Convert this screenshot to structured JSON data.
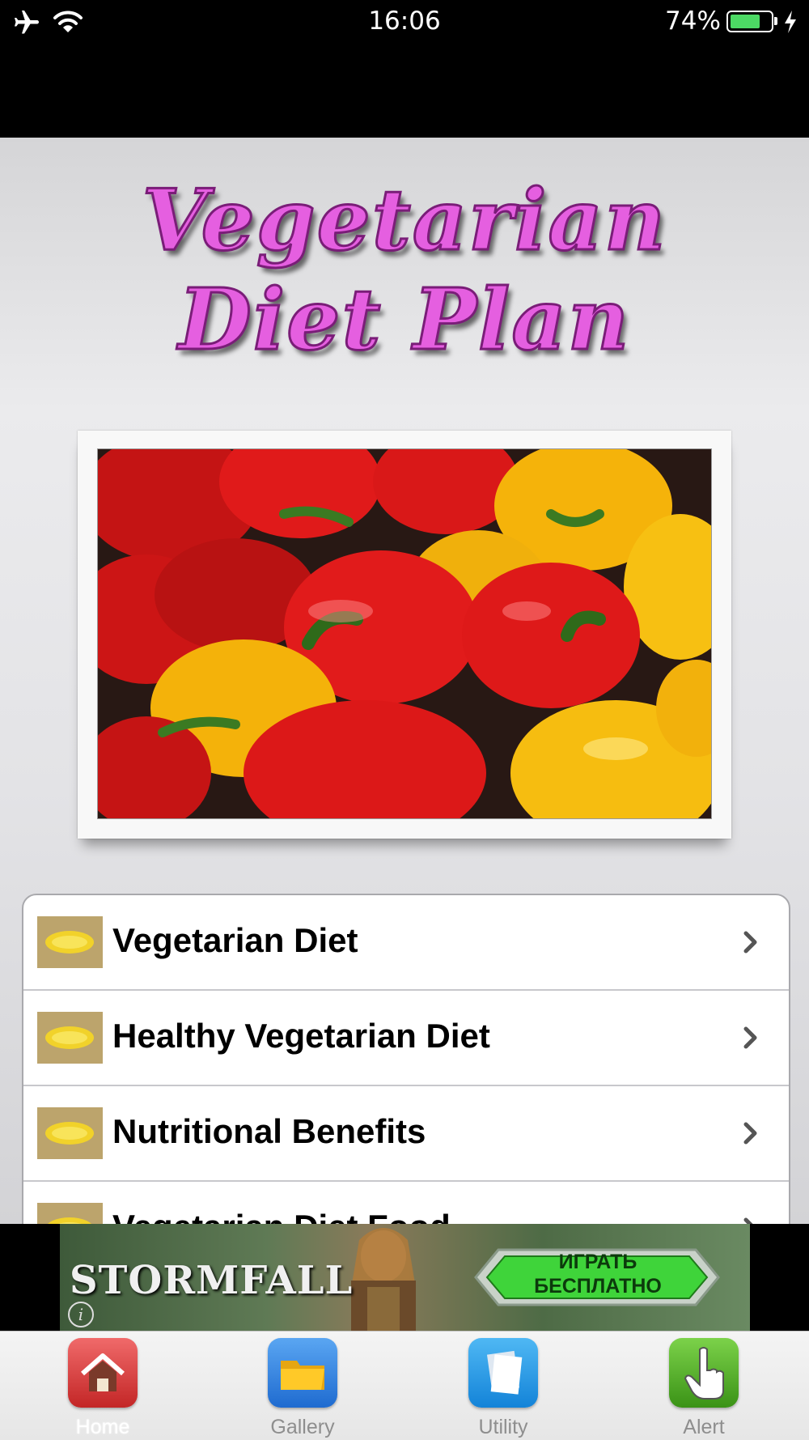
{
  "status_bar": {
    "time": "16:06",
    "battery_percent": "74%",
    "battery_level": 0.74,
    "icons": [
      "airplane-icon",
      "wifi-icon",
      "battery-icon",
      "charging-bolt-icon"
    ]
  },
  "header": {
    "title": "Vegetarian Diet Plan"
  },
  "hero_image": {
    "subject": "red and yellow bell peppers"
  },
  "menu": {
    "items": [
      {
        "label": "Vegetarian Diet",
        "icon": "lemon-thumbnail"
      },
      {
        "label": "Healthy Vegetarian Diet",
        "icon": "lemon-thumbnail"
      },
      {
        "label": "Nutritional Benefits",
        "icon": "lemon-thumbnail"
      },
      {
        "label": "Vegetarian Diet Food",
        "icon": "lemon-thumbnail"
      }
    ]
  },
  "ad_banner": {
    "brand": "STORMFALL",
    "cta": "ИГРАТЬ БЕСПЛАТНО",
    "info_icon": "i"
  },
  "tab_bar": {
    "tabs": [
      {
        "label": "Home",
        "icon": "home-icon",
        "active": true
      },
      {
        "label": "Gallery",
        "icon": "folder-icon",
        "active": false
      },
      {
        "label": "Utility",
        "icon": "documents-icon",
        "active": false
      },
      {
        "label": "Alert",
        "icon": "pointing-hand-icon",
        "active": false
      }
    ]
  },
  "colors": {
    "title_fill": "#e55fe0",
    "battery_fill": "#4cd964",
    "home_tab": "#d63a3a",
    "gallery_tab": "#2f7fe0",
    "utility_tab": "#1e98e8",
    "alert_tab": "#4aa51e"
  }
}
